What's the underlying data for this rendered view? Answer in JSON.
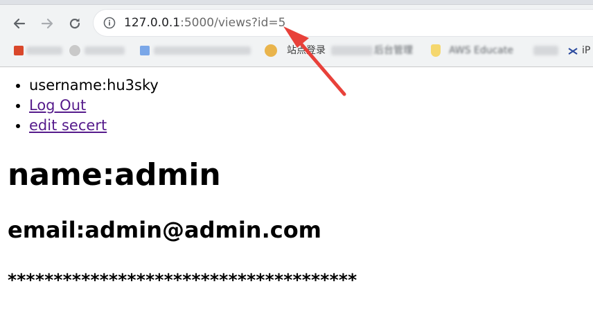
{
  "browser": {
    "url_host": "127.0.0.1",
    "url_rest": ":5000/views?id=5",
    "bookmarks": [
      {
        "label": "站点登录",
        "icon": "globe-icon"
      },
      {
        "label": "后台管理",
        "icon": "bookmark-icon"
      },
      {
        "label": "AWS Educate",
        "icon": "shield-icon"
      },
      {
        "label": "iP",
        "icon": "logo-icon"
      }
    ]
  },
  "nav": {
    "username": "username:hu3sky",
    "logout": "Log Out",
    "edit": "edit secert"
  },
  "profile": {
    "name": "name:admin",
    "email": "email:admin@admin.com",
    "secret": "**************************************"
  },
  "colors": {
    "link": "#551a8b",
    "annotation_arrow": "#e8413a"
  }
}
